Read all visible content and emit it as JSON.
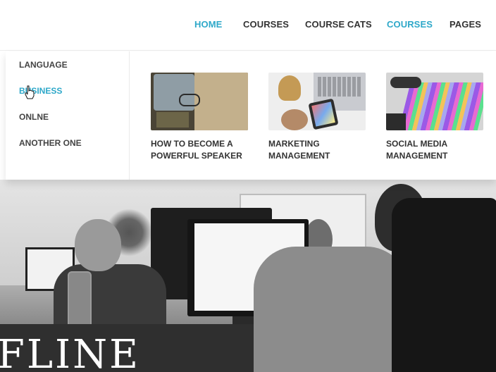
{
  "nav": {
    "items": [
      {
        "label": "HOME",
        "active": true
      },
      {
        "label": "COURSES",
        "active": false
      },
      {
        "label": "COURSE CATS",
        "active": false
      },
      {
        "label": "COURSES",
        "active": true
      },
      {
        "label": "PAGES",
        "active": false
      }
    ]
  },
  "dropdown": {
    "categories": [
      {
        "label": "LANGUAGE"
      },
      {
        "label": "BUSINESS",
        "hovered": true
      },
      {
        "label": "ONLNE"
      },
      {
        "label": "ANOTHER ONE"
      }
    ],
    "courses": [
      {
        "title_line1": "HOW TO BECOME A",
        "title_line2": "POWERFUL SPEAKER",
        "thumb_icon": "books-glasses-photo"
      },
      {
        "title_line1": "MARKETING",
        "title_line2": "MANAGEMENT",
        "thumb_icon": "laptop-phone-photo"
      },
      {
        "title_line1": "SOCIAL MEDIA",
        "title_line2": "MANAGEMENT",
        "thumb_icon": "colorful-notes-photo"
      }
    ]
  },
  "hero": {
    "title_fragment": "FLINE"
  },
  "colors": {
    "accent": "#2ea8c9",
    "text": "#333333",
    "nav_border": "#ececec"
  },
  "cursor_icon": "hand-pointer-icon"
}
